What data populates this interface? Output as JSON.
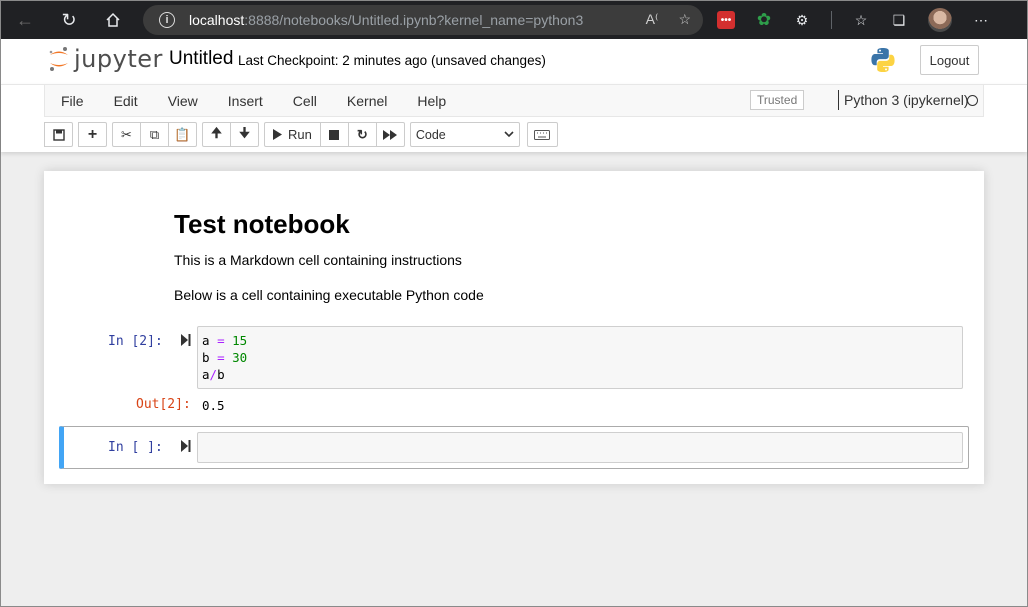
{
  "browser": {
    "url_host": "localhost",
    "url_rest": ":8888/notebooks/Untitled.ipynb?kernel_name=python3"
  },
  "header": {
    "logo_text": "jupyter",
    "notebook_title": "Untitled",
    "checkpoint": "Last Checkpoint: 2 minutes ago",
    "unsaved": "(unsaved changes)",
    "logout_label": "Logout"
  },
  "menubar": {
    "items": [
      {
        "label": "File"
      },
      {
        "label": "Edit"
      },
      {
        "label": "View"
      },
      {
        "label": "Insert"
      },
      {
        "label": "Cell"
      },
      {
        "label": "Kernel"
      },
      {
        "label": "Help"
      }
    ],
    "trusted_label": "Trusted",
    "kernel_name": "Python 3 (ipykernel)"
  },
  "toolbar": {
    "run_label": "Run",
    "cell_type": "Code"
  },
  "notebook": {
    "markdown": {
      "heading": "Test notebook",
      "paragraph1": "This is a Markdown cell containing instructions",
      "paragraph2": "Below is a cell containing executable Python code"
    },
    "code_cell": {
      "in_prompt": "In [2]:",
      "lines": [
        {
          "var": "a",
          "op": "=",
          "num": "15"
        },
        {
          "var": "b",
          "op": "=",
          "num": "30"
        }
      ],
      "line3_a": "a",
      "line3_op": "/",
      "line3_b": "b",
      "out_prompt": "Out[2]:",
      "output": "0.5"
    },
    "empty_cell": {
      "in_prompt": "In [ ]:"
    }
  }
}
